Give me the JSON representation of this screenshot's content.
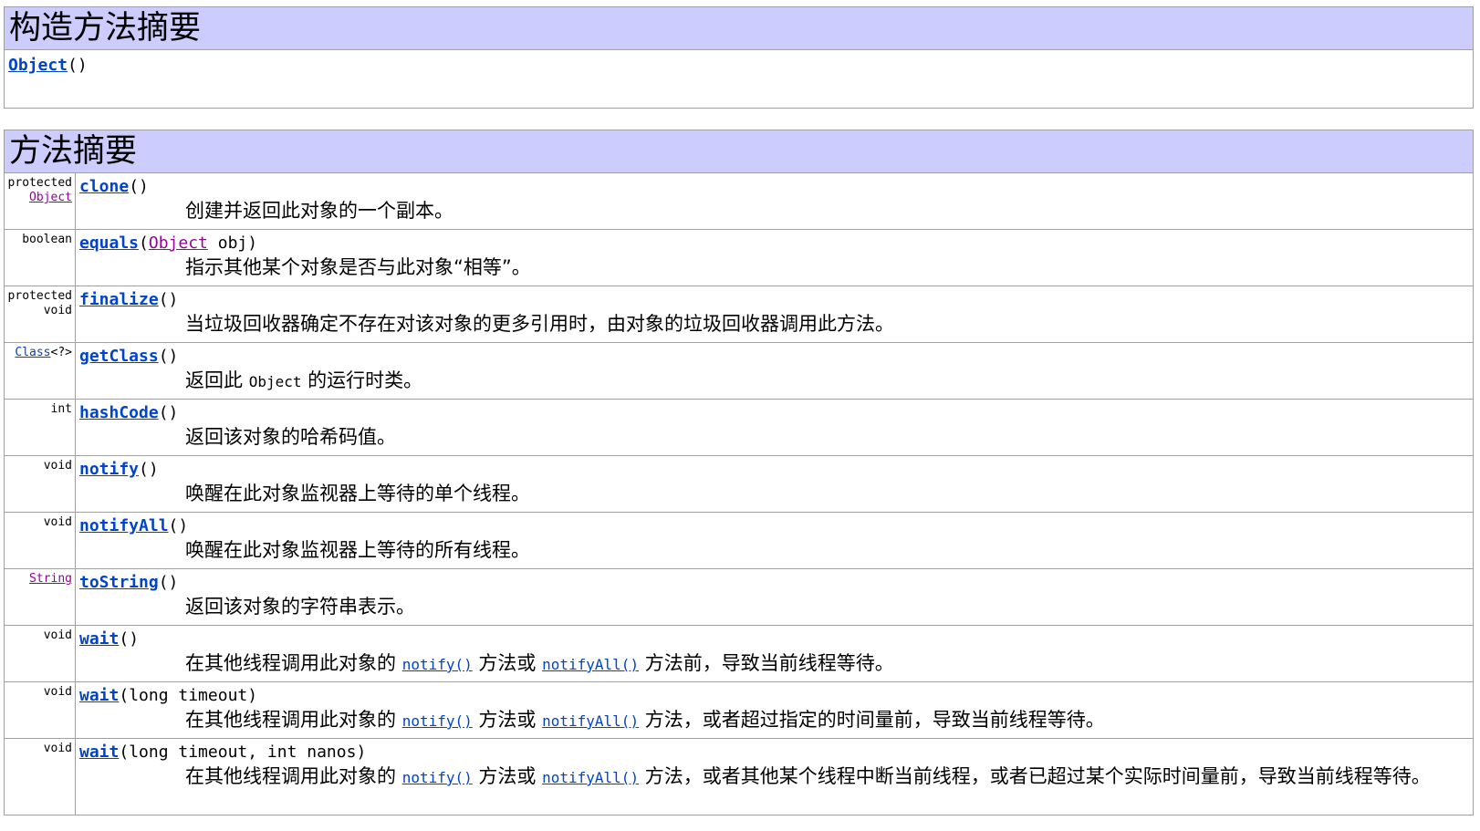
{
  "constructor_summary": {
    "title": "构造方法摘要",
    "ctor_name": "Object",
    "ctor_params": "()"
  },
  "method_summary": {
    "title": "方法摘要",
    "rows": [
      {
        "mod": "protected",
        "type": "Object",
        "name": "clone",
        "params": "()",
        "desc": "创建并返回此对象的一个副本。"
      },
      {
        "mod": "",
        "type": "boolean",
        "name": "equals",
        "params_open": "(",
        "param_type": "Object",
        "params_close": " obj)",
        "desc": "指示其他某个对象是否与此对象“相等”。"
      },
      {
        "mod": "protected",
        "type": "void",
        "name": "finalize",
        "params": "()",
        "desc": "当垃圾回收器确定不存在对该对象的更多引用时，由对象的垃圾回收器调用此方法。"
      },
      {
        "mod": "",
        "type": "Class",
        "type_suffix": "<?>",
        "name": "getClass",
        "params": "()",
        "desc_pre": "返回此 ",
        "desc_code": "Object",
        "desc_post": " 的运行时类。"
      },
      {
        "mod": "",
        "type": "int",
        "name": "hashCode",
        "params": "()",
        "desc": "返回该对象的哈希码值。"
      },
      {
        "mod": "",
        "type": "void",
        "name": "notify",
        "params": "()",
        "desc": "唤醒在此对象监视器上等待的单个线程。"
      },
      {
        "mod": "",
        "type": "void",
        "name": "notifyAll",
        "params": "()",
        "desc": "唤醒在此对象监视器上等待的所有线程。"
      },
      {
        "mod": "",
        "type": "String",
        "name": "toString",
        "params": "()",
        "desc": "返回该对象的字符串表示。"
      },
      {
        "mod": "",
        "type": "void",
        "name": "wait",
        "params": "()",
        "desc_a": "在其他线程调用此对象的 ",
        "link1": "notify()",
        "desc_b": " 方法或 ",
        "link2": "notifyAll()",
        "desc_c": " 方法前，导致当前线程等待。"
      },
      {
        "mod": "",
        "type": "void",
        "name": "wait",
        "params": "(long timeout)",
        "desc_a": "在其他线程调用此对象的 ",
        "link1": "notify()",
        "desc_b": " 方法或 ",
        "link2": "notifyAll()",
        "desc_c": " 方法，或者超过指定的时间量前，导致当前线程等待。"
      },
      {
        "mod": "",
        "type": "void",
        "name": "wait",
        "params": "(long timeout, int nanos)",
        "desc_a": "在其他线程调用此对象的 ",
        "link1": "notify()",
        "desc_b": " 方法或 ",
        "link2": "notifyAll()",
        "desc_c": " 方法，或者其他某个线程中断当前线程，或者已超过某个实际时间量前，导致当前线程等待。"
      }
    ]
  }
}
